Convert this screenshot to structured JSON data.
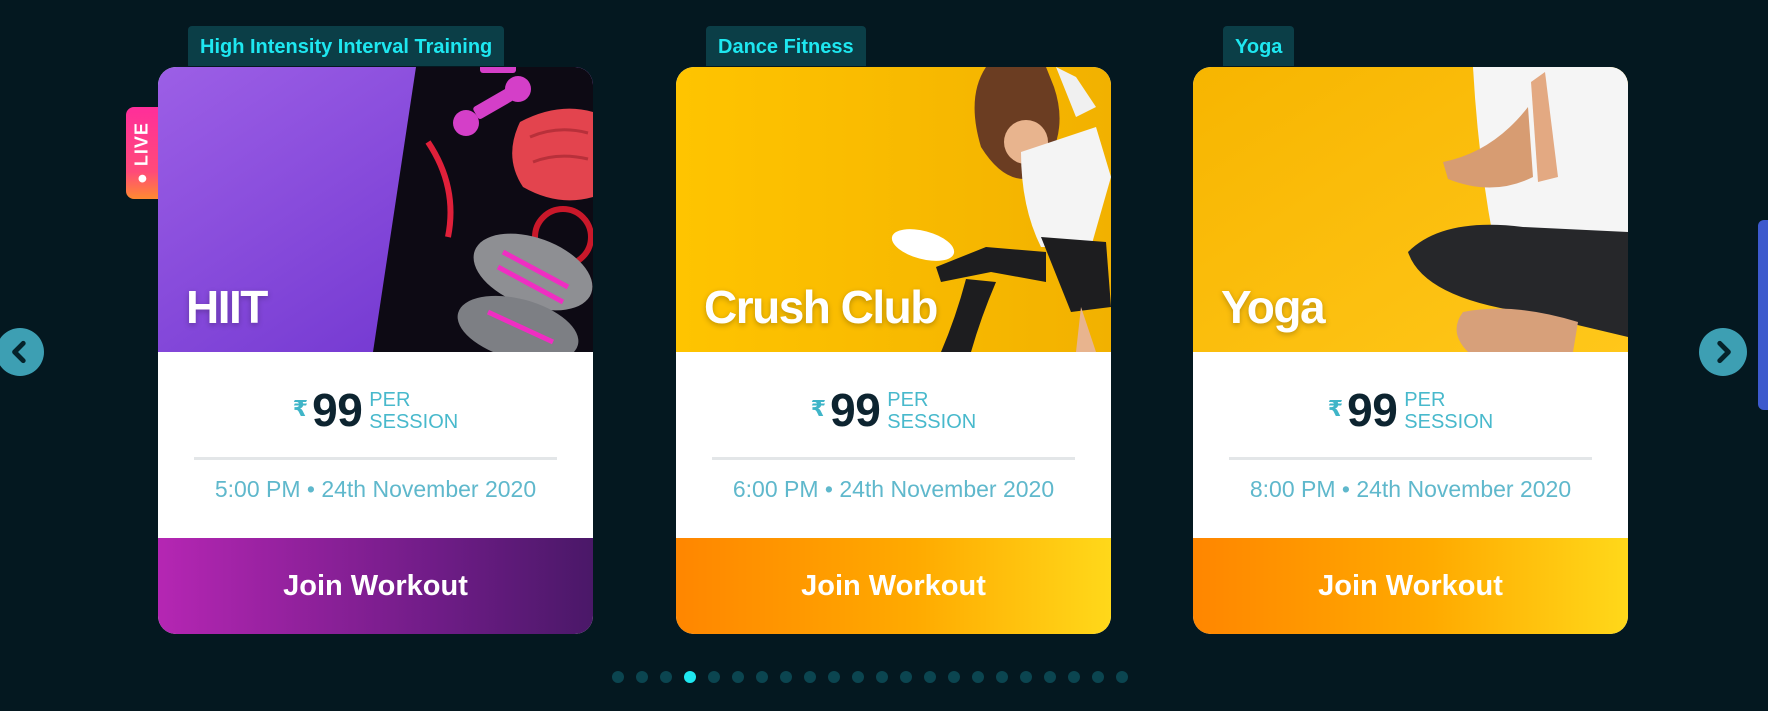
{
  "cards": [
    {
      "tag": "High Intensity Interval Training",
      "title": "HIIT",
      "currency": "₹",
      "price": "99",
      "unit_line1": "PER",
      "unit_line2": "SESSION",
      "time": "5:00 PM • 24th November 2020",
      "cta": "Join Workout",
      "live_badge": "● LIVE"
    },
    {
      "tag": "Dance Fitness",
      "title": "Crush Club",
      "currency": "₹",
      "price": "99",
      "unit_line1": "PER",
      "unit_line2": "SESSION",
      "time": "6:00 PM • 24th November 2020",
      "cta": "Join Workout"
    },
    {
      "tag": "Yoga",
      "title": "Yoga",
      "currency": "₹",
      "price": "99",
      "unit_line1": "PER",
      "unit_line2": "SESSION",
      "time": "8:00 PM • 24th November 2020",
      "cta": "Join Workout"
    }
  ],
  "nav": {
    "prev_icon": "chevron-left-icon",
    "next_icon": "chevron-right-icon"
  },
  "pagination": {
    "total": 22,
    "active_index": 3
  },
  "colors": {
    "background": "#041820",
    "accent": "#1ee7f0",
    "hiit_purple": "#7c3bd8",
    "yellow": "#ffc107",
    "live": "#ff2e9a"
  }
}
